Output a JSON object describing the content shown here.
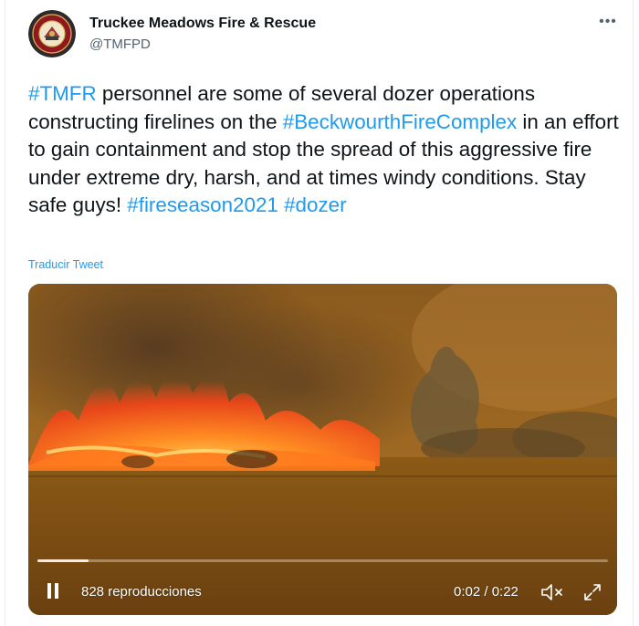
{
  "author": {
    "name": "Truckee Meadows Fire & Rescue",
    "handle": "@TMFPD"
  },
  "tweet": {
    "text_parts": [
      {
        "text": "#TMFR",
        "link": true
      },
      {
        "text": " personnel are some of several dozer operations constructing firelines on the ",
        "link": false
      },
      {
        "text": "#BeckwourthFireComplex",
        "link": true
      },
      {
        "text": " in an effort to gain containment and stop the spread of this aggressive fire under extreme dry, harsh, and at times windy conditions. Stay safe guys! ",
        "link": false
      },
      {
        "text": "#fireseason2021",
        "link": true
      },
      {
        "text": " ",
        "link": false
      },
      {
        "text": "#dozer",
        "link": true
      }
    ],
    "translate_label": "Traducir Tweet"
  },
  "video": {
    "views": "828 reproducciones",
    "time": "0:02 / 0:22",
    "progress_fraction": 0.09
  },
  "icons": {
    "more": "more-icon",
    "pause": "pause-icon",
    "mute": "volume-muted-icon",
    "expand": "expand-icon"
  },
  "colors": {
    "link": "#1d9bf0",
    "text": "#0f1419",
    "secondary": "#536471"
  }
}
